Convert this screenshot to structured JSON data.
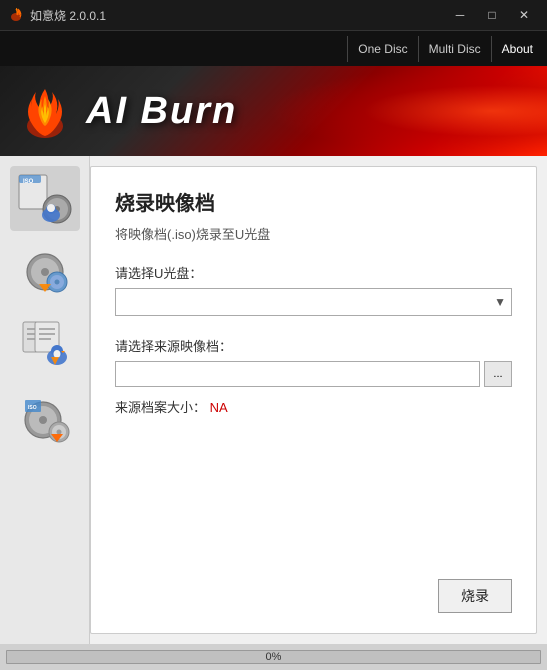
{
  "window": {
    "title": "如意烧 2.0.0.1",
    "minimize_label": "─",
    "maximize_label": "□",
    "close_label": "✕"
  },
  "nav": {
    "one_disc": "One Disc",
    "multi_disc": "Multi Disc",
    "about": "About"
  },
  "header": {
    "app_name": "AI Burn"
  },
  "content": {
    "section_title": "烧录映像档",
    "section_subtitle": "将映像档(.iso)烧录至U光盘",
    "drive_label": "请选择U光盘：",
    "file_label": "请选择来源映像档：",
    "file_size_label": "来源档案大小：",
    "file_size_value": "NA",
    "browse_label": "...",
    "burn_label": "烧录"
  },
  "progress": {
    "label": "0%",
    "value": 0
  },
  "colors": {
    "accent_red": "#cc0000",
    "brand_dark": "#1a1a1a"
  }
}
